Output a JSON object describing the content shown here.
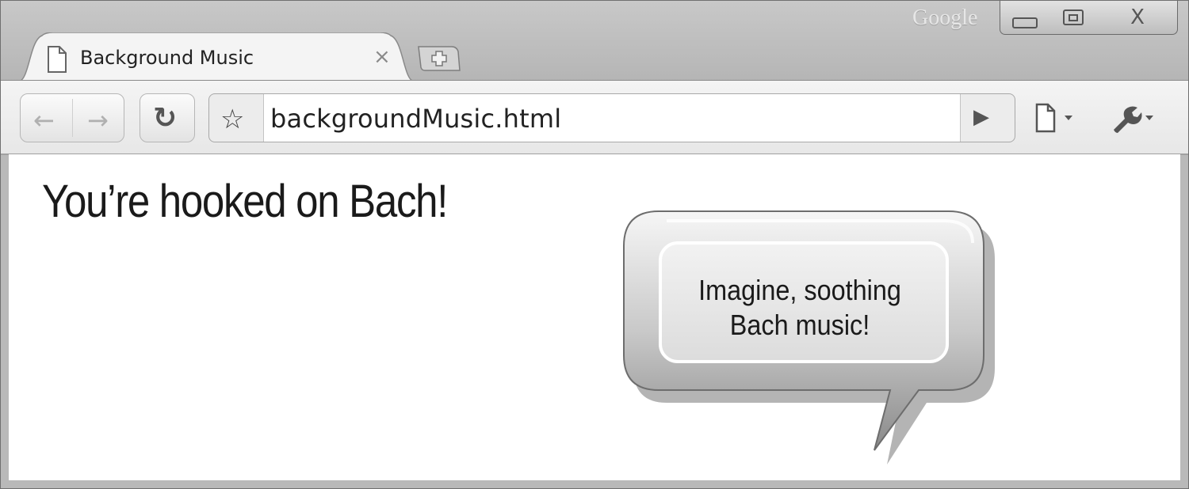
{
  "window": {
    "brand": "Google",
    "controls": {
      "minimize": "minimize",
      "maximize": "maximize",
      "close": "X"
    }
  },
  "tab": {
    "title": "Background Music",
    "close_label": "×",
    "icon": "page-icon"
  },
  "toolbar": {
    "back_icon": "←",
    "forward_icon": "→",
    "reload_icon": "↻",
    "star_icon": "☆",
    "url": "backgroundMusic.html",
    "go_icon": "▶",
    "page_menu_icon": "page-icon",
    "wrench_menu_icon": "wrench-icon"
  },
  "page": {
    "heading": "You’re hooked on Bach!",
    "bubble": {
      "line1": "Imagine, soothing",
      "line2": "Bach music!"
    }
  }
}
